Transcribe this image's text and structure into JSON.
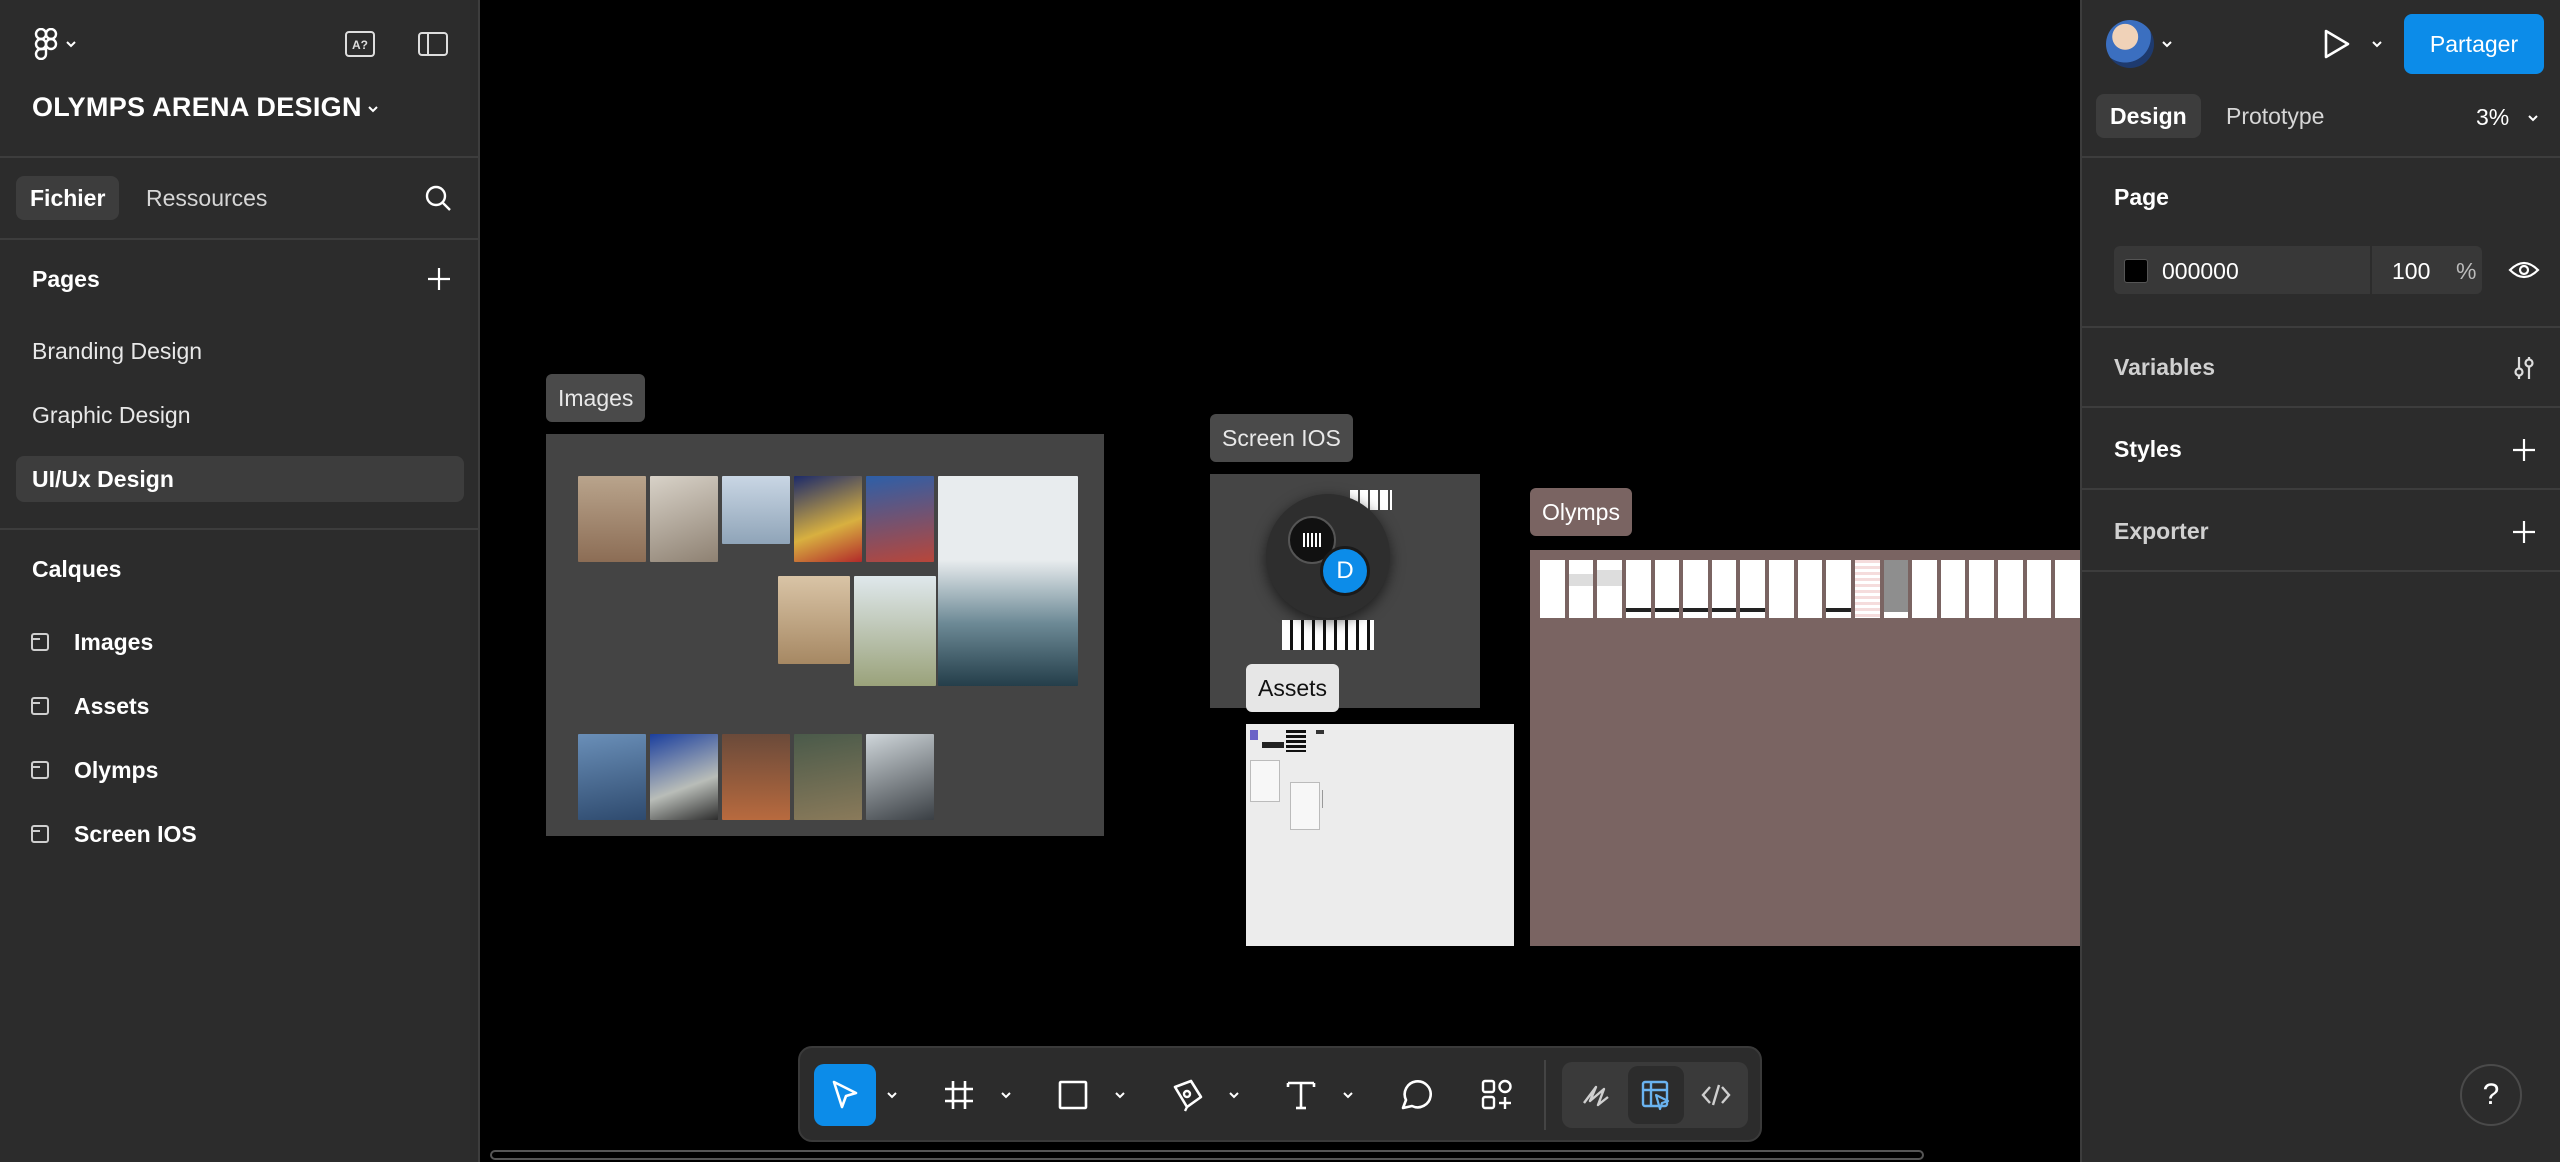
{
  "left_panel": {
    "project_title": "OLYMPS ARENA DESIGN",
    "tabs": {
      "file": "Fichier",
      "resources": "Ressources"
    },
    "pages_title": "Pages",
    "pages": [
      "Branding Design",
      "Graphic Design",
      "UI/Ux Design"
    ],
    "selected_page": "UI/Ux Design",
    "layers_title": "Calques",
    "layers": [
      "Images",
      "Assets",
      "Olymps",
      "Screen IOS"
    ]
  },
  "canvas": {
    "frames": {
      "images": "Images",
      "screen_ios": "Screen IOS",
      "assets": "Assets",
      "olymps": "Olymps"
    },
    "avatar_letter": "D"
  },
  "right_panel": {
    "share_label": "Partager",
    "tabs": {
      "design": "Design",
      "prototype": "Prototype"
    },
    "zoom": "3%",
    "page_section": "Page",
    "page_color_hex": "000000",
    "page_opacity": "100",
    "percent_sign": "%",
    "variables": "Variables",
    "styles": "Styles",
    "exporter": "Exporter"
  },
  "colors": {
    "accent": "#0c8ce9",
    "panel": "#2c2c2c",
    "canvas": "#000000"
  },
  "help_label": "?"
}
